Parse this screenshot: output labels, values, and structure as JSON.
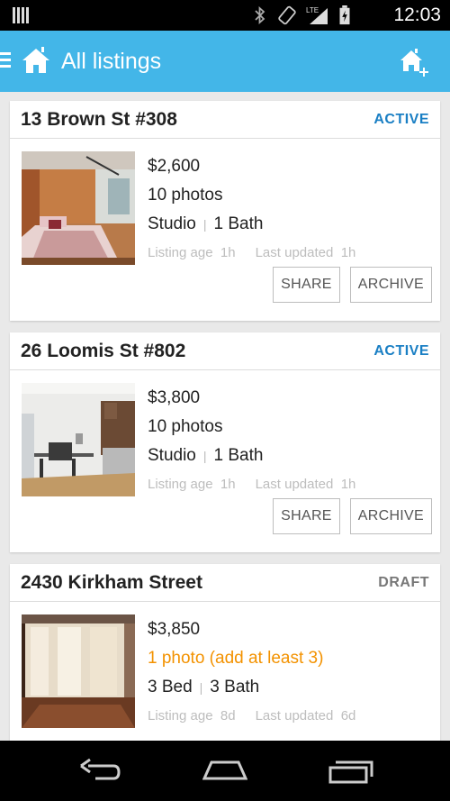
{
  "status_bar": {
    "time": "12:03",
    "icons": [
      "bluetooth-icon",
      "rotate-icon",
      "lte-signal-icon",
      "battery-charging-icon"
    ]
  },
  "app_bar": {
    "title": "All listings",
    "color": "#43b6e8"
  },
  "listings": [
    {
      "address": "13 Brown St #308",
      "status": "ACTIVE",
      "price": "$2,600",
      "photos": "10 photos",
      "photos_warning": false,
      "beds": "Studio",
      "baths": "1 Bath",
      "listing_age_label": "Listing age",
      "listing_age": "1h",
      "updated_label": "Last updated",
      "updated": "1h",
      "share_label": "SHARE",
      "archive_label": "ARCHIVE"
    },
    {
      "address": "26 Loomis St #802",
      "status": "ACTIVE",
      "price": "$3,800",
      "photos": "10 photos",
      "photos_warning": false,
      "beds": "Studio",
      "baths": "1 Bath",
      "listing_age_label": "Listing age",
      "listing_age": "1h",
      "updated_label": "Last updated",
      "updated": "1h",
      "share_label": "SHARE",
      "archive_label": "ARCHIVE"
    },
    {
      "address": "2430 Kirkham Street",
      "status": "DRAFT",
      "price": "$3,850",
      "photos": "1 photo (add at least 3)",
      "photos_warning": true,
      "beds": "3 Bed",
      "baths": "3 Bath",
      "listing_age_label": "Listing age",
      "listing_age": "8d",
      "updated_label": "Last updated",
      "updated": "6d"
    }
  ],
  "colors": {
    "active": "#1a7fc4",
    "draft": "#777777",
    "warning": "#f39200"
  }
}
